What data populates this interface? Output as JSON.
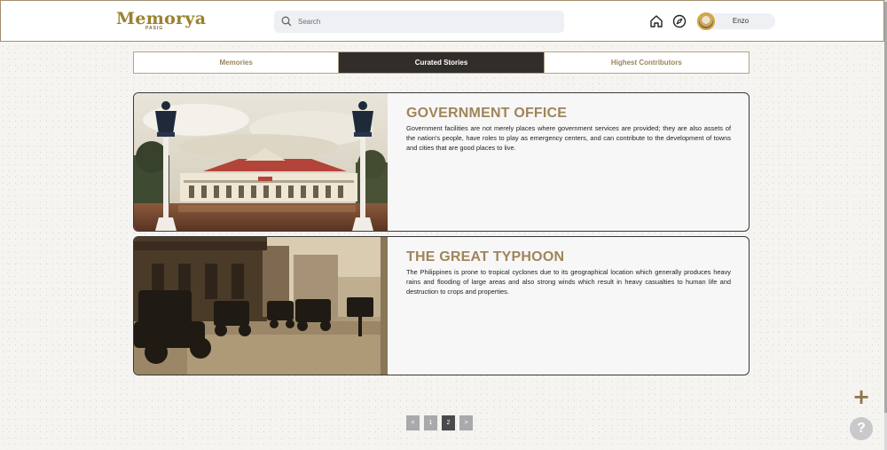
{
  "header": {
    "logo_text": "Memorya",
    "logo_subtext": "PASIG",
    "search_placeholder": "Search",
    "user_name": "Enzo"
  },
  "icons": {
    "search": "search-icon",
    "home": "home-icon",
    "explore": "compass-icon",
    "avatar": "user-avatar",
    "add": "plus-icon",
    "help": "question-icon"
  },
  "tabs": [
    {
      "label": "Memories",
      "active": false
    },
    {
      "label": "Curated Stories",
      "active": true
    },
    {
      "label": "Highest Contributors",
      "active": false
    }
  ],
  "stories": [
    {
      "title": "GOVERNMENT OFFICE",
      "description": "Government facilities are not merely places where government services are provided; they are also assets of the nation's people, have roles to play as emergency centers, and can contribute to the development of towns and cities that are good places to live."
    },
    {
      "title": "THE GREAT TYPHOON",
      "description": "The Philippines is prone to tropical cyclones due to its geographical location which generally produces heavy rains and flooding of large areas and also strong winds which result in heavy casualties to human life and destruction to crops and properties."
    }
  ],
  "pagination": {
    "prev": "<",
    "pages": [
      "1",
      "2"
    ],
    "current": "2",
    "next": ">"
  },
  "fab": {
    "add_label": "+",
    "help_label": "?"
  },
  "colors": {
    "accent": "#a08559",
    "active_tab": "#302d2a",
    "logo": "#9b8030"
  }
}
